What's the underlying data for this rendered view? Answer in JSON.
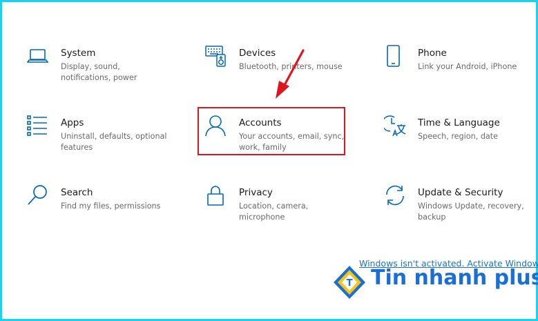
{
  "colors": {
    "accent": "#0067c0",
    "highlight": "#e0141e",
    "frame": "#14d4f0",
    "brand_blue": "#1a6fd6",
    "brand_yellow": "#f5c518"
  },
  "tiles": [
    {
      "title": "System",
      "desc": "Display, sound, notifications, power",
      "icon": "laptop-icon"
    },
    {
      "title": "Devices",
      "desc": "Bluetooth, printers, mouse",
      "icon": "keyboard-speaker-icon"
    },
    {
      "title": "Phone",
      "desc": "Link your Android, iPhone",
      "icon": "phone-icon"
    },
    {
      "title": "Apps",
      "desc": "Uninstall, defaults, optional features",
      "icon": "list-icon"
    },
    {
      "title": "Accounts",
      "desc": "Your accounts, email, sync, work, family",
      "icon": "person-icon"
    },
    {
      "title": "Time & Language",
      "desc": "Speech, region, date",
      "icon": "time-language-icon"
    },
    {
      "title": "Search",
      "desc": "Find my files, permissions",
      "icon": "search-icon"
    },
    {
      "title": "Privacy",
      "desc": "Location, camera, microphone",
      "icon": "lock-icon"
    },
    {
      "title": "Update & Security",
      "desc": "Windows Update, recovery, backup",
      "icon": "sync-icon"
    }
  ],
  "watermark": {
    "activation_text": "Windows isn't activated. Activate Windows n",
    "brand_text": "Tin nhanh plus",
    "logo_letter": "T"
  }
}
